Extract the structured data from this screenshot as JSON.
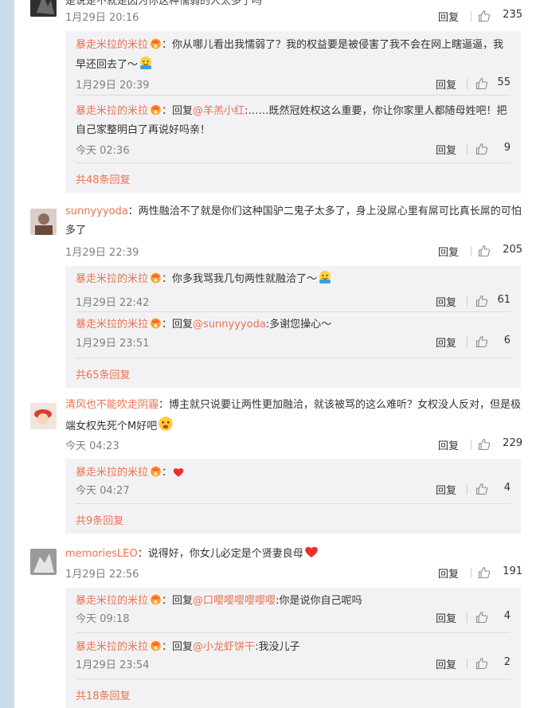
{
  "colors": {
    "accent": "#eb7350",
    "subbg": "#f2f2f5",
    "leftbar": "#c9dcea"
  },
  "icons": {
    "like": "thumbs-up-icon",
    "badge": "vip-badge-icon",
    "emoji": "emoji-icon",
    "heart": "heart-icon"
  },
  "reply_label": "回复",
  "comments": [
    {
      "user": "",
      "text": "是说是不就是因为你这种懦弱的人太多了吗",
      "time": "1月29日 20:16",
      "likes": "235",
      "replies": [
        {
          "user": "暴走米拉的米拉",
          "prefix": "",
          "mention": "",
          "text": "你从哪儿看出我懦弱了？我的权益要是被侵害了我不会在网上瞎逼逼，我早还回去了～",
          "time": "1月29日 20:39",
          "likes": "55"
        },
        {
          "user": "暴走米拉的米拉",
          "prefix": "回复",
          "mention": "@羊羔小红",
          "text": ":……既然冠姓权这么重要，你让你家里人都随母姓吧！把自己家整明白了再说好吗亲！",
          "time": "今天 02:36",
          "likes": "9"
        }
      ],
      "more": "共48条回复"
    },
    {
      "user": "sunnyyyoda",
      "text": "两性融洽不了就是你们这种国驴二鬼子太多了，身上没屌心里有屌可比真长屌的可怕多了",
      "time": "1月29日 22:39",
      "likes": "205",
      "replies": [
        {
          "user": "暴走米拉的米拉",
          "prefix": "",
          "mention": "",
          "text": "你多我骂我几句两性就融洽了～",
          "time": "1月29日 22:42",
          "likes": "61"
        },
        {
          "user": "暴走米拉的米拉",
          "prefix": "回复",
          "mention": "@sunnyyyoda",
          "text": ":多谢您操心～",
          "time": "1月29日 23:51",
          "likes": "6"
        }
      ],
      "more": "共65条回复"
    },
    {
      "user": "清风也不能吹走阴霾",
      "text": "博主就只说要让两性更加融洽，就该被骂的这么难听？女权没人反对，但是极端女权先死个M好吧",
      "time": "今天 04:23",
      "likes": "229",
      "replies": [
        {
          "user": "暴走米拉的米拉",
          "prefix": "",
          "mention": "",
          "text": "",
          "time": "今天 04:27",
          "likes": "4"
        }
      ],
      "more": "共9条回复"
    },
    {
      "user": "memoriesLEO",
      "text": "说得好，你女儿必定是个贤妻良母",
      "time": "1月29日 22:56",
      "likes": "191",
      "replies": [
        {
          "user": "暴走米拉的米拉",
          "prefix": "回复",
          "mention": "@口嘤嘤嘤嘤嘤嘤",
          "text": ":你是说你自己呢吗",
          "time": "今天 09:18",
          "likes": "4"
        },
        {
          "user": "暴走米拉的米拉",
          "prefix": "回复",
          "mention": "@小龙虾饼干",
          "text": ":我没儿子",
          "time": "1月29日 23:54",
          "likes": "2"
        }
      ],
      "more": "共18条回复"
    }
  ]
}
